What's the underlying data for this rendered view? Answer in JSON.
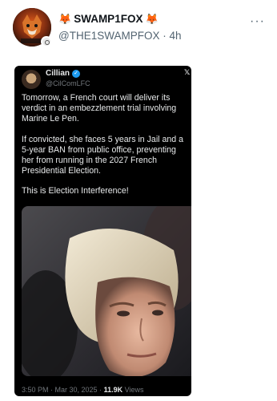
{
  "post": {
    "display_name": "SWAMP1FOX",
    "name_emoji": "🦊",
    "handle": "@THE1SWAMPFOX",
    "separator": "·",
    "time": "4h",
    "more_icon": "more-horizontal-icon"
  },
  "embedded": {
    "author_name": "Cillian",
    "author_handle": "@CilComLFC",
    "verified_icon": "verified-badge-icon",
    "paragraphs": [
      "Tomorrow, a French court will deliver its verdict in an embezzlement trial involving Marine Le Pen.",
      "If convicted, she faces 5 years in Jail and a 5-year BAN from public office, preventing her from running in the 2027 French Presidential Election.",
      "This is Election Interference!"
    ],
    "footer_time": "3:50 PM · Mar 30, 2025 ·",
    "views_count": "11.9K",
    "views_label": "Views"
  },
  "colors": {
    "text_primary": "#0f1419",
    "text_secondary": "#536471",
    "card_bg": "#000000",
    "verified_blue": "#1d9bf0"
  }
}
